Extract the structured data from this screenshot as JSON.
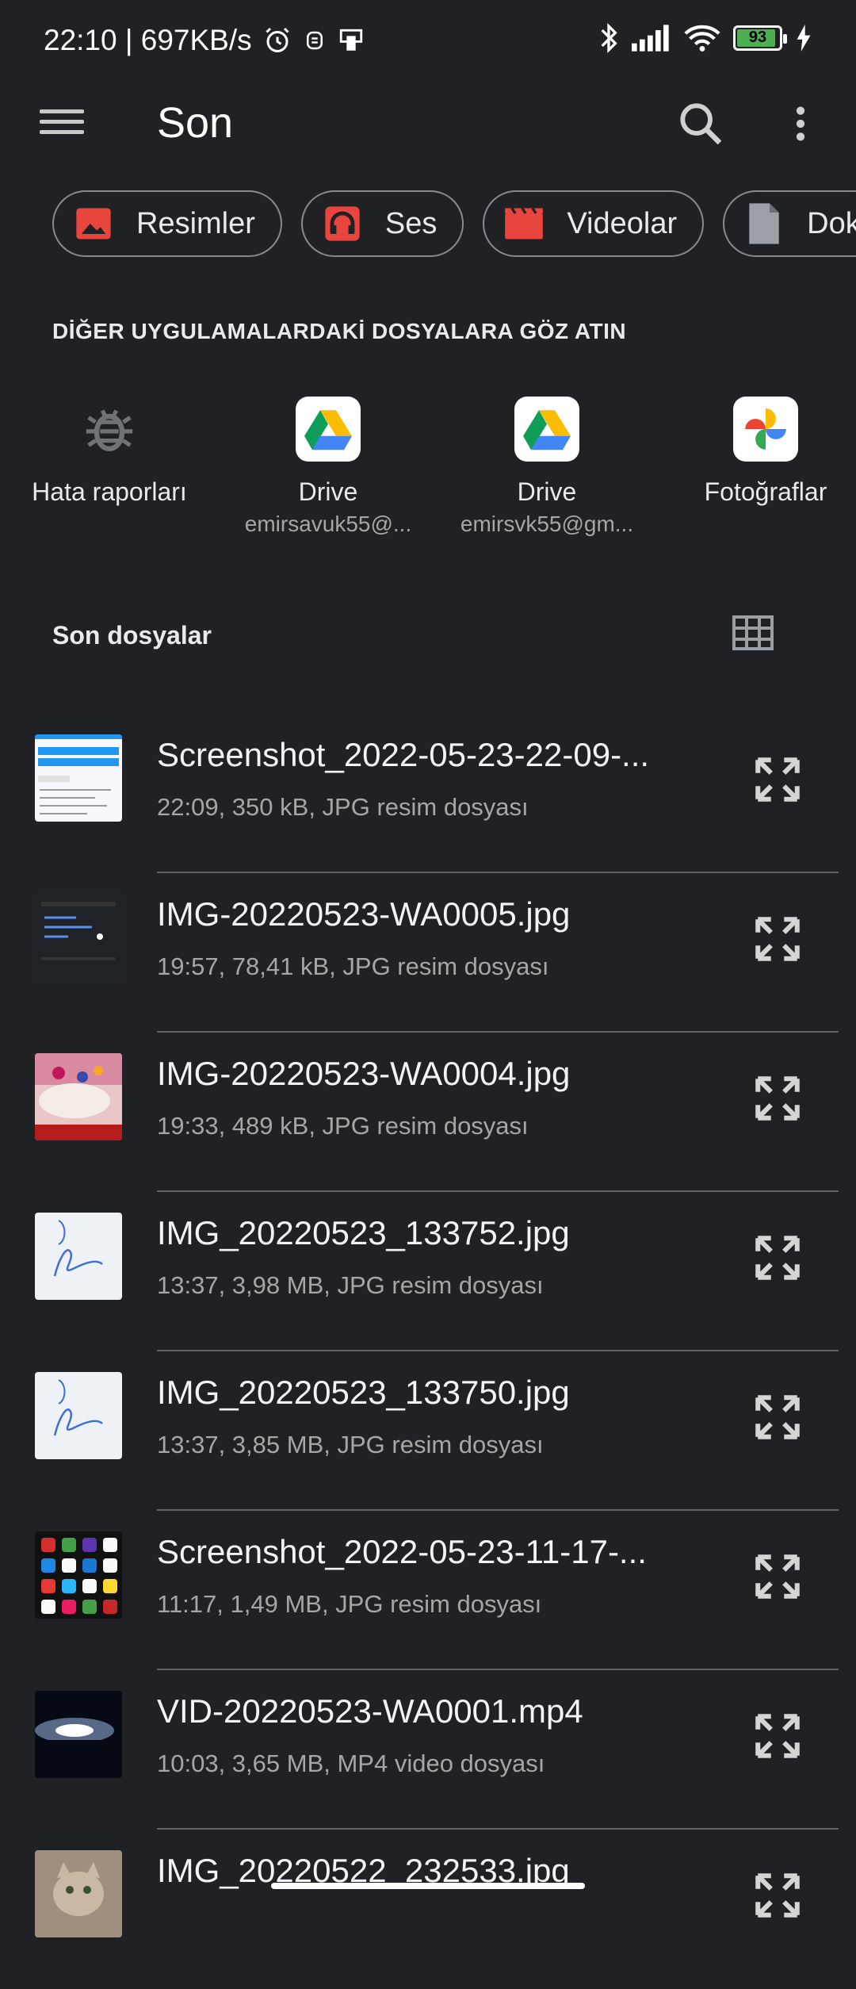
{
  "status_bar": {
    "time_speed": "22:10 | 697KB/s",
    "battery": "93",
    "icons": [
      "alarm-icon",
      "notification-icon",
      "device-icon",
      "bluetooth-icon",
      "signal-icon",
      "wifi-icon",
      "battery-icon",
      "charging-icon"
    ]
  },
  "app_bar": {
    "title": "Son"
  },
  "chips": [
    {
      "label": "Resimler",
      "icon": "image-icon"
    },
    {
      "label": "Ses",
      "icon": "headphones-icon"
    },
    {
      "label": "Videolar",
      "icon": "video-icon"
    },
    {
      "label": "Dok",
      "icon": "document-icon"
    }
  ],
  "apps_section": {
    "title": "DİĞER UYGULAMALARDAKİ DOSYALARA GÖZ ATIN",
    "apps": [
      {
        "name": "Hata raporları",
        "sub": ""
      },
      {
        "name": "Drive",
        "sub": "emirsavuk55@..."
      },
      {
        "name": "Drive",
        "sub": "emirsvk55@gm..."
      },
      {
        "name": "Fotoğraflar",
        "sub": ""
      }
    ]
  },
  "recent": {
    "title": "Son dosyalar",
    "files": [
      {
        "name": "Screenshot_2022-05-23-22-09-...",
        "meta": "22:09, 350 kB, JPG resim dosyası"
      },
      {
        "name": "IMG-20220523-WA0005.jpg",
        "meta": "19:57, 78,41 kB, JPG resim dosyası"
      },
      {
        "name": "IMG-20220523-WA0004.jpg",
        "meta": "19:33, 489 kB, JPG resim dosyası"
      },
      {
        "name": "IMG_20220523_133752.jpg",
        "meta": "13:37, 3,98 MB, JPG resim dosyası"
      },
      {
        "name": "IMG_20220523_133750.jpg",
        "meta": "13:37, 3,85 MB, JPG resim dosyası"
      },
      {
        "name": "Screenshot_2022-05-23-11-17-...",
        "meta": "11:17, 1,49 MB, JPG resim dosyası"
      },
      {
        "name": "VID-20220523-WA0001.mp4",
        "meta": "10:03, 3,65 MB, MP4 video dosyası"
      },
      {
        "name": "IMG_20220522_232533.jpg",
        "meta": ""
      }
    ]
  },
  "colors": {
    "background": "#202124",
    "chip_image": "#e8453c",
    "battery": "#4caf50"
  }
}
